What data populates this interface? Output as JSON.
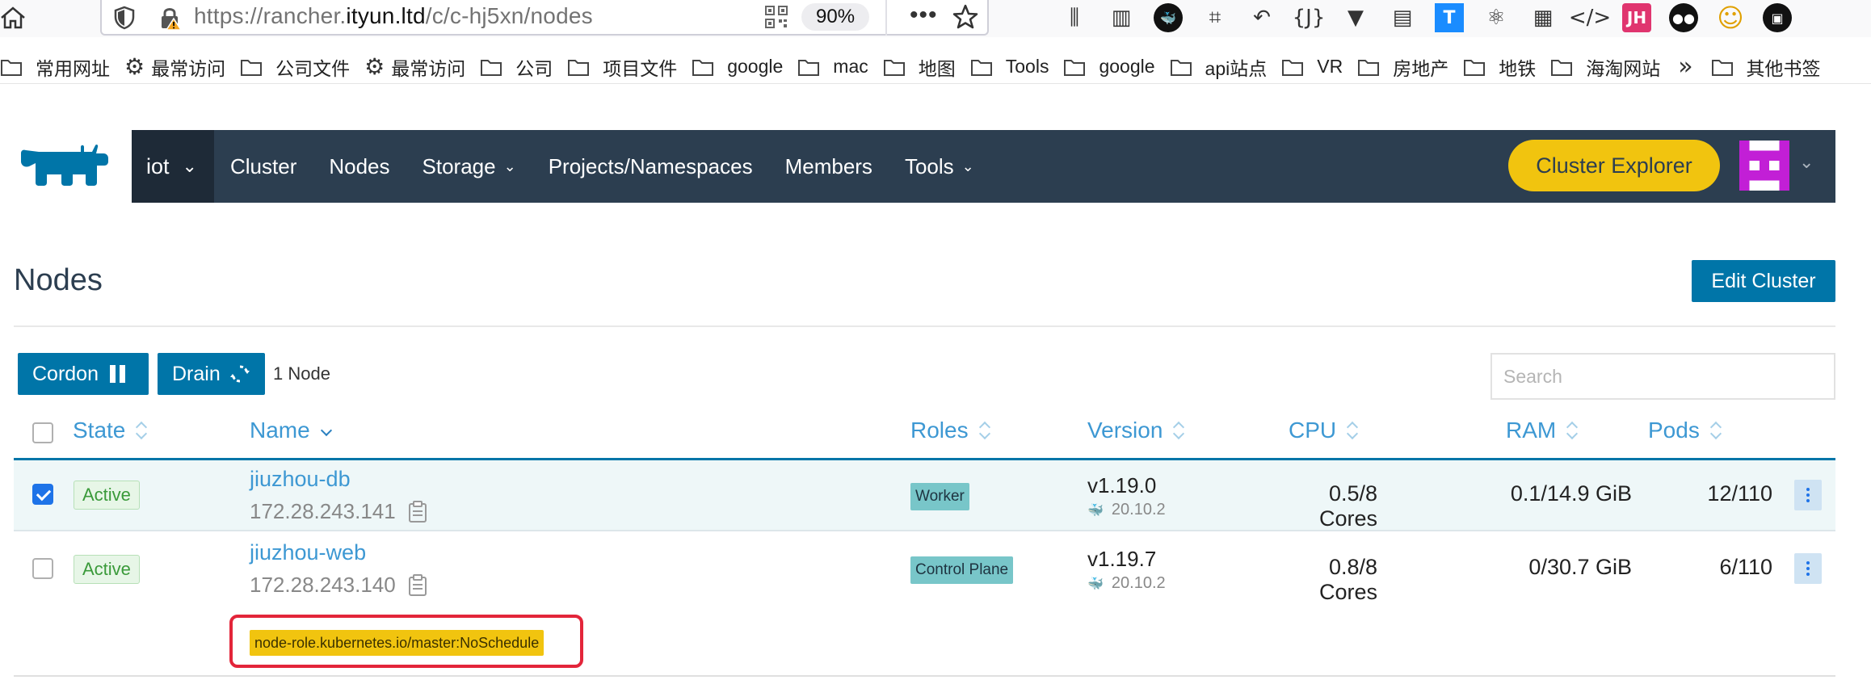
{
  "browser": {
    "url_prefix": "https://rancher.",
    "url_domain": "ityun.ltd",
    "url_path": "/c/c-hj5xn/nodes",
    "zoom": "90%",
    "toolbar_icons": [
      {
        "icon": "library-icon",
        "glyph": "⫼"
      },
      {
        "icon": "reader-view-icon",
        "glyph": "▥"
      },
      {
        "icon": "docker-extension-icon",
        "glyph": "🐳"
      },
      {
        "icon": "crop-icon",
        "glyph": "⌗"
      },
      {
        "icon": "undo-icon",
        "glyph": "↶"
      },
      {
        "icon": "json-extension-icon",
        "glyph": "{J}"
      },
      {
        "icon": "vue-devtools-icon",
        "glyph": "▼"
      },
      {
        "icon": "notes-icon",
        "glyph": "▤"
      },
      {
        "icon": "translate-extension-icon",
        "glyph": "T"
      },
      {
        "icon": "react-devtools-icon",
        "glyph": "⚛"
      },
      {
        "icon": "qrcode-extension-icon",
        "glyph": "▦"
      },
      {
        "icon": "code-icon",
        "glyph": "</>"
      },
      {
        "icon": "jh-extension-icon",
        "glyph": "JH"
      },
      {
        "icon": "tampermonkey-icon",
        "glyph": "●●"
      },
      {
        "icon": "emoji-icon",
        "glyph": "☺"
      },
      {
        "icon": "terminal-extension-icon",
        "glyph": "▣"
      }
    ],
    "bookmarks": [
      {
        "label": "常用网址",
        "icon": "folder"
      },
      {
        "label": "最常访问",
        "icon": "gear"
      },
      {
        "label": "公司文件",
        "icon": "folder"
      },
      {
        "label": "最常访问",
        "icon": "gear"
      },
      {
        "label": "公司",
        "icon": "folder"
      },
      {
        "label": "项目文件",
        "icon": "folder"
      },
      {
        "label": "google",
        "icon": "folder"
      },
      {
        "label": "mac",
        "icon": "folder"
      },
      {
        "label": "地图",
        "icon": "folder"
      },
      {
        "label": "Tools",
        "icon": "folder"
      },
      {
        "label": "google",
        "icon": "folder"
      },
      {
        "label": "api站点",
        "icon": "folder"
      },
      {
        "label": "VR",
        "icon": "folder"
      },
      {
        "label": "房地产",
        "icon": "folder"
      },
      {
        "label": "地铁",
        "icon": "folder"
      },
      {
        "label": "海淘网站",
        "icon": "folder"
      }
    ],
    "bookmarks_overflow": "»",
    "other_bookmarks": "其他书签"
  },
  "nav": {
    "cluster": "iot",
    "items": [
      {
        "label": "Cluster",
        "dropdown": false
      },
      {
        "label": "Nodes",
        "dropdown": false
      },
      {
        "label": "Storage",
        "dropdown": true
      },
      {
        "label": "Projects/Namespaces",
        "dropdown": false
      },
      {
        "label": "Members",
        "dropdown": false
      },
      {
        "label": "Tools",
        "dropdown": true
      }
    ],
    "explorer_button": "Cluster Explorer"
  },
  "page": {
    "title": "Nodes",
    "edit_button": "Edit Cluster",
    "cordon_button": "Cordon",
    "drain_button": "Drain",
    "node_count": "1 Node",
    "search_placeholder": "Search"
  },
  "table": {
    "headers": {
      "state": "State",
      "name": "Name",
      "roles": "Roles",
      "version": "Version",
      "cpu": "CPU",
      "ram": "RAM",
      "pods": "Pods"
    },
    "rows": [
      {
        "selected": true,
        "state": "Active",
        "name": "jiuzhou-db",
        "ip": "172.28.243.141",
        "role": "Worker",
        "version": "v1.19.0",
        "docker": "20.10.2",
        "cpu": "0.5/8 Cores",
        "ram": "0.1/14.9 GiB",
        "pods": "12/110"
      },
      {
        "selected": false,
        "state": "Active",
        "name": "jiuzhou-web",
        "ip": "172.28.243.140",
        "role": "Control Plane",
        "version": "v1.19.7",
        "docker": "20.10.2",
        "cpu": "0.8/8 Cores",
        "ram": "0/30.7 GiB",
        "pods": "6/110",
        "taint": "node-role.kubernetes.io/master:NoSchedule"
      }
    ]
  },
  "colors": {
    "navbar": "#2c3e50",
    "primary": "#0075a8",
    "accent_yellow": "#f1c40f",
    "link": "#3d98d3",
    "highlight_box": "#e3253a"
  }
}
